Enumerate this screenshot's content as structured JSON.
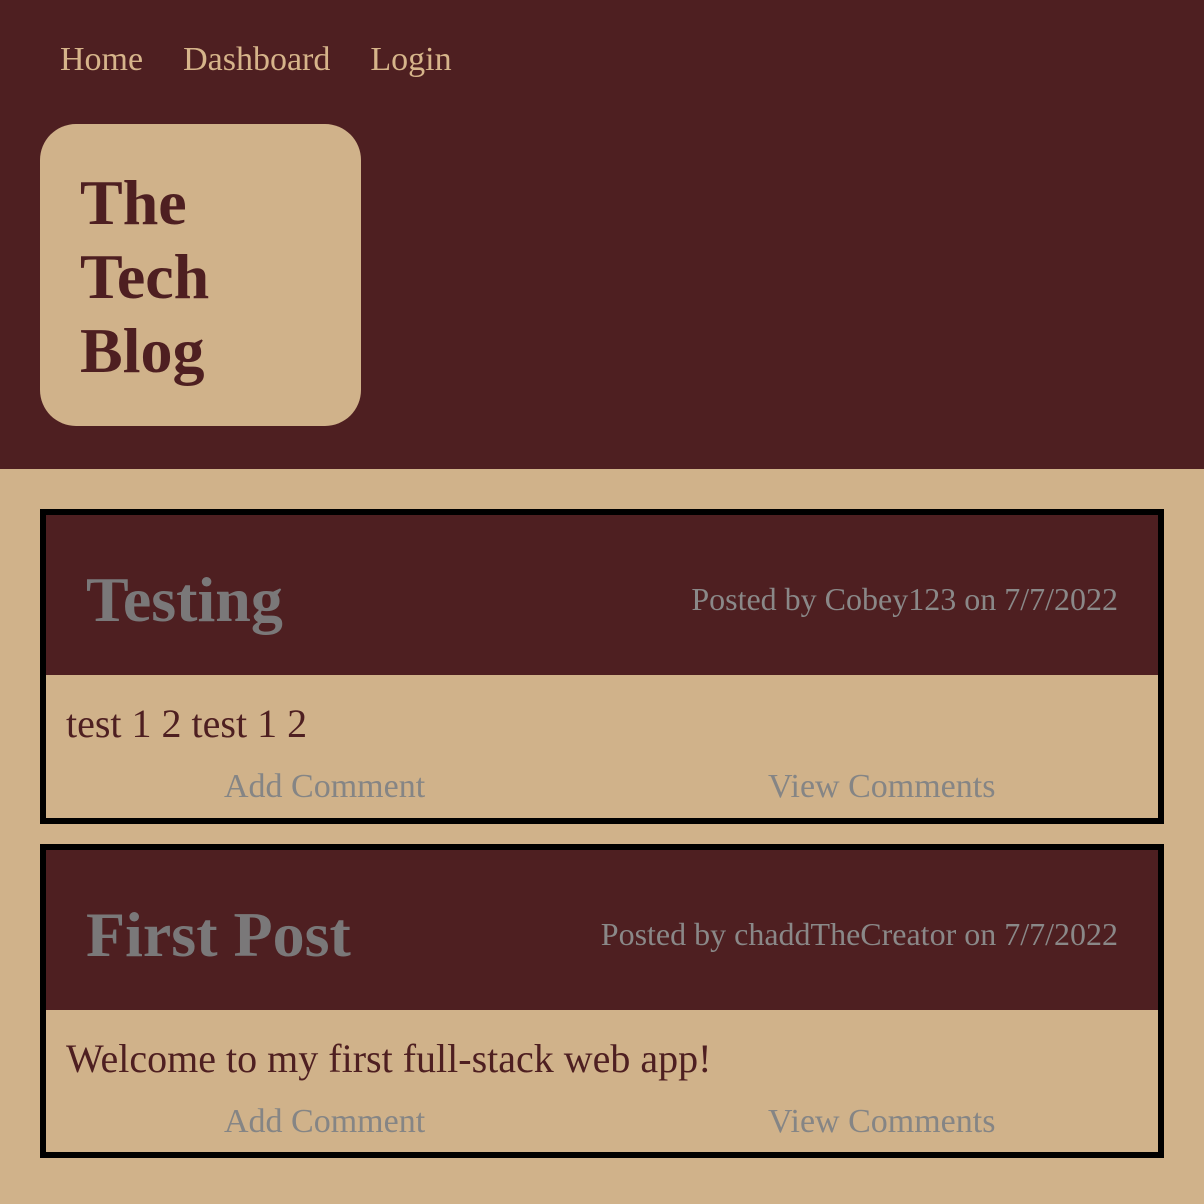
{
  "nav": {
    "home": "Home",
    "dashboard": "Dashboard",
    "login": "Login"
  },
  "brand": {
    "title_line_1": "The",
    "title_line_2": "Tech",
    "title_line_3": "Blog"
  },
  "posts": [
    {
      "title": "Testing",
      "meta": "Posted by Cobey123 on 7/7/2022",
      "body": "test 1 2 test 1 2",
      "add_comment_label": "Add Comment",
      "view_comments_label": "View Comments"
    },
    {
      "title": "First Post",
      "meta": "Posted by chaddTheCreator on 7/7/2022",
      "body": "Welcome to my first full-stack web app!",
      "add_comment_label": "Add Comment",
      "view_comments_label": "View Comments"
    }
  ],
  "colors": {
    "header_bg": "#4e1f21",
    "page_bg": "#d0b28a",
    "nav_text": "#d6b48a",
    "muted_text": "#858585"
  }
}
